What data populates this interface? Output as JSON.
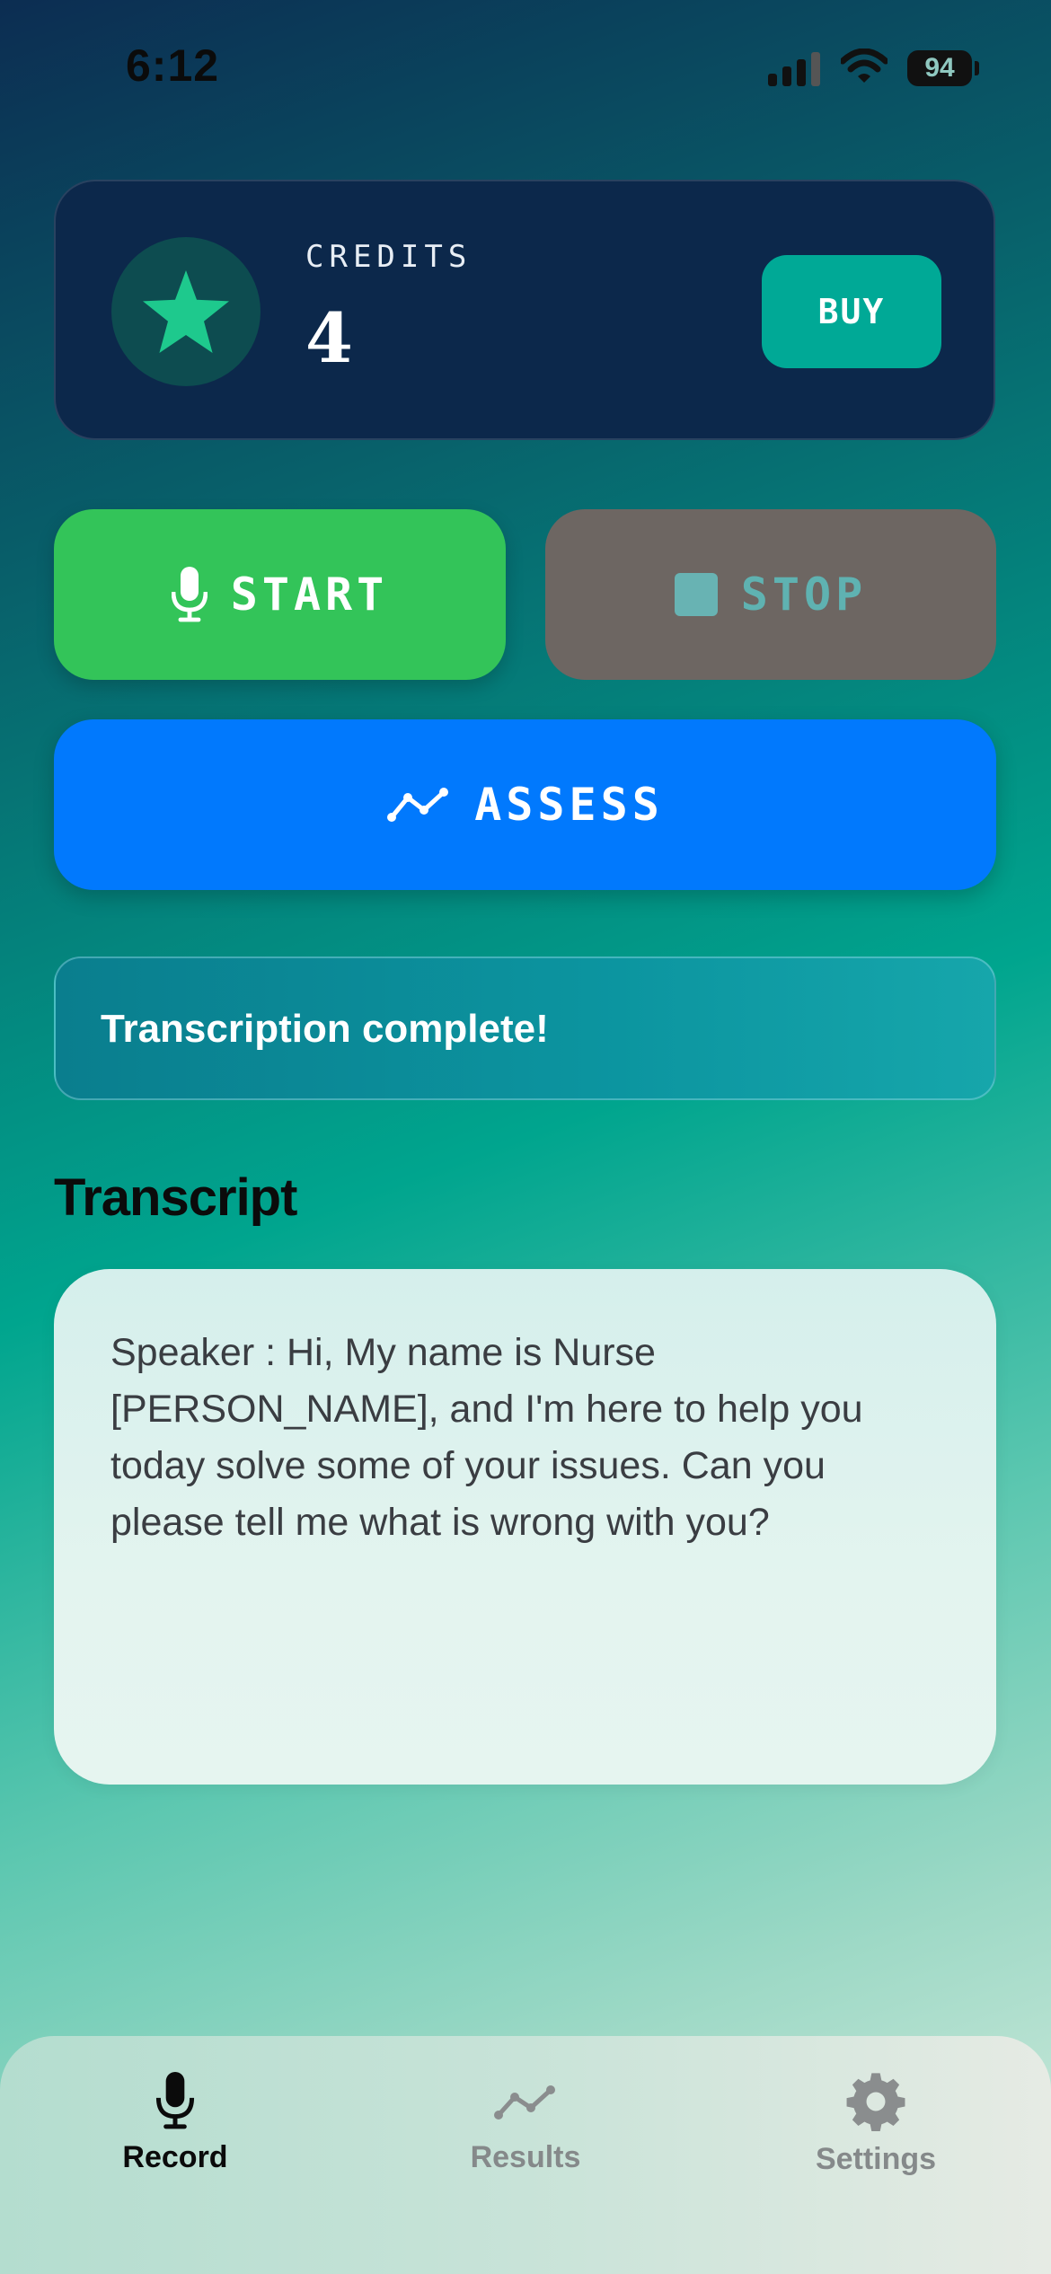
{
  "status_bar": {
    "time": "6:12",
    "battery": "94"
  },
  "credits": {
    "label": "CREDITS",
    "value": "4",
    "buy_label": "BUY"
  },
  "controls": {
    "start_label": "START",
    "stop_label": "STOP",
    "assess_label": "ASSESS"
  },
  "status_message": "Transcription complete!",
  "transcript": {
    "title": "Transcript",
    "text": "Speaker : Hi, My name is Nurse [PERSON_NAME], and I'm here to help you today solve some of your issues. Can you please tell me what is wrong with you?"
  },
  "tab_bar": {
    "tabs": [
      {
        "label": "Record",
        "icon": "mic-icon",
        "active": true
      },
      {
        "label": "Results",
        "icon": "chart-line-icon",
        "active": false
      },
      {
        "label": "Settings",
        "icon": "gear-icon",
        "active": false
      }
    ]
  },
  "colors": {
    "start": "#33C459",
    "assess": "#0179FD",
    "buy": "#00A996",
    "credits_card": "#0C284B"
  }
}
